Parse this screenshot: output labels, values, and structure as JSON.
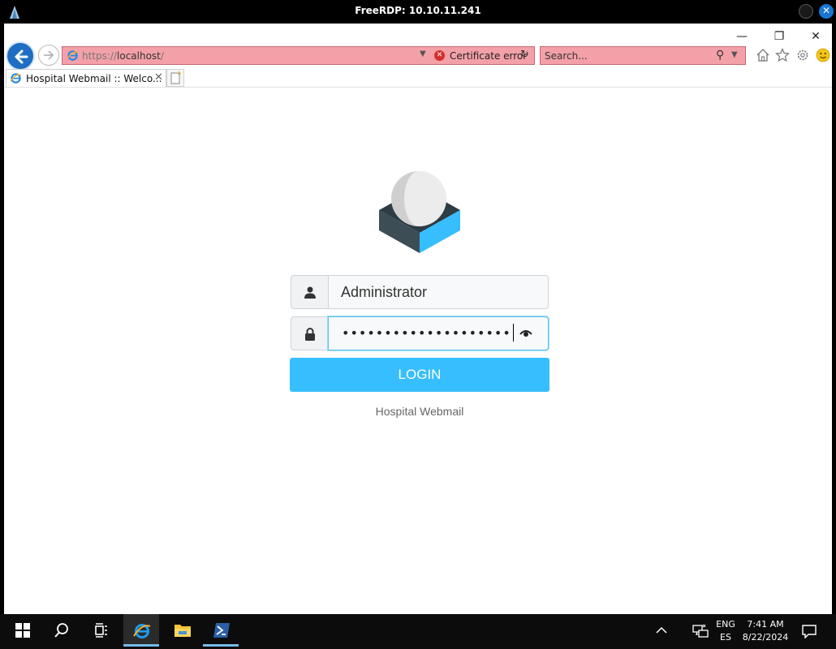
{
  "rdp": {
    "title": "FreeRDP: 10.10.11.241"
  },
  "browser": {
    "address": {
      "prefix": "https://",
      "host": "localhost",
      "suffix": "/"
    },
    "certificate_error": "Certificate error",
    "search_placeholder": "Search...",
    "tab_label": "Hospital Webmail :: Welco...",
    "accent": "#1e6fc4",
    "error_bar_color": "#f4a0a8"
  },
  "login": {
    "username_value": "Administrator",
    "password_mask": "••••••••••••••••••••",
    "login_label": "LOGIN",
    "footer": "Hospital Webmail",
    "button_color": "#37beff",
    "icons": {
      "logo": "roundcube-logo",
      "user": "user-icon",
      "lock": "lock-icon",
      "reveal": "eye-icon"
    }
  },
  "taskbar": {
    "language_code": "ENG",
    "keyboard_layout": "ES",
    "time": "7:41 AM",
    "date": "8/22/2024",
    "apps": [
      "start-icon",
      "search-icon",
      "task-view-icon",
      "internet-explorer-icon",
      "file-explorer-icon",
      "powershell-icon"
    ]
  }
}
